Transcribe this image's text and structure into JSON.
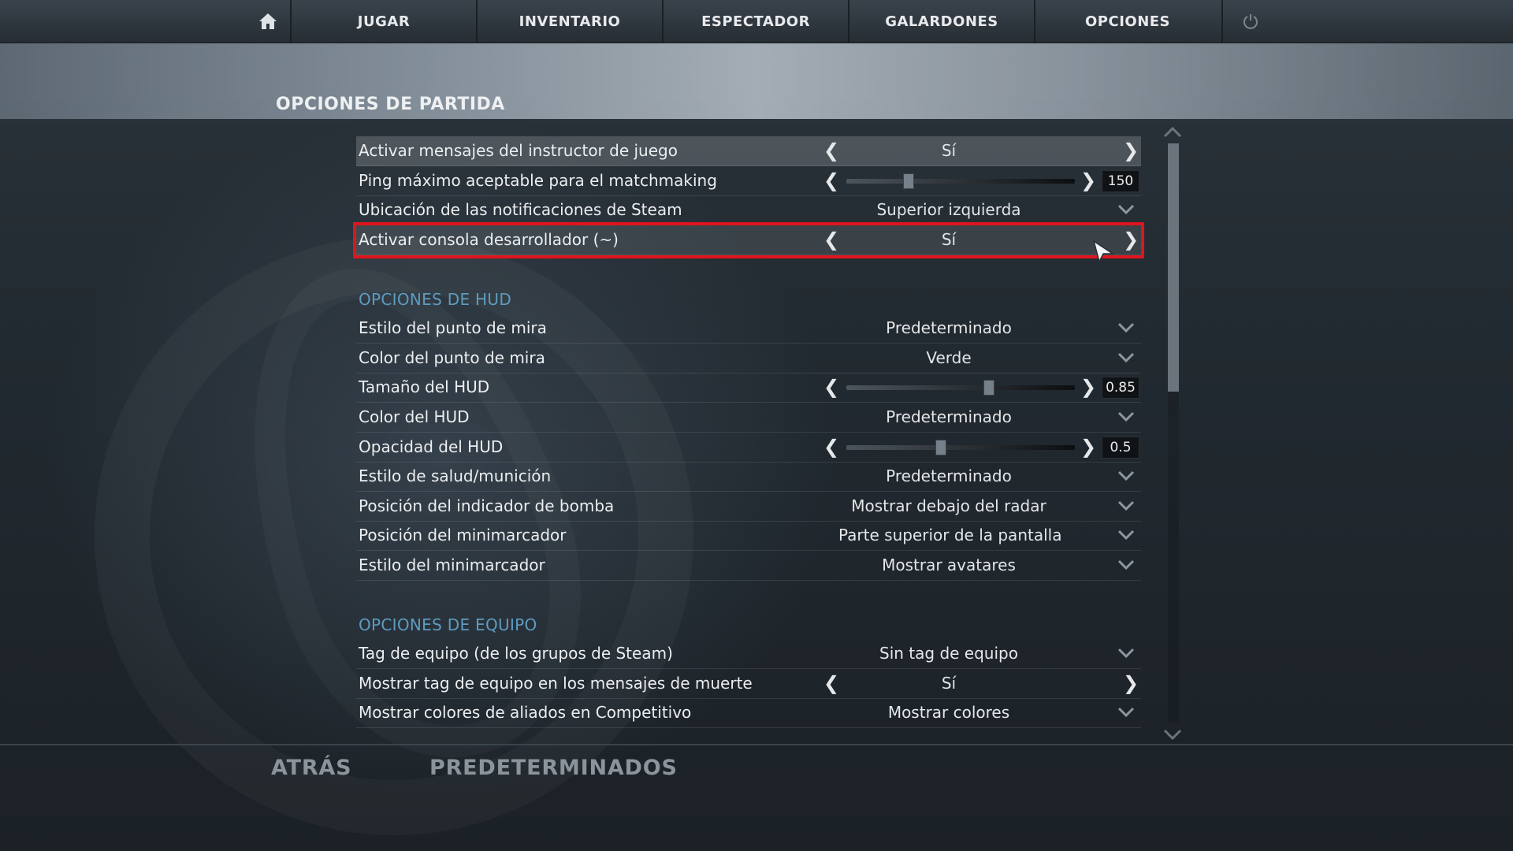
{
  "nav": {
    "home_icon": "home-icon",
    "items": [
      "JUGAR",
      "INVENTARIO",
      "ESPECTADOR",
      "GALARDONES",
      "OPCIONES"
    ],
    "power_icon": "power-icon"
  },
  "page_title": "OPCIONES DE PARTIDA",
  "rows": {
    "instructor": {
      "label": "Activar mensajes del instructor de juego",
      "value": "Sí"
    },
    "ping": {
      "label": "Ping máximo aceptable para el matchmaking",
      "value": "150",
      "fraction": 0.27
    },
    "steam_notif": {
      "label": "Ubicación de las notificaciones de Steam",
      "value": "Superior izquierda"
    },
    "dev_console": {
      "label": "Activar consola desarrollador (~)",
      "value": "Sí"
    }
  },
  "hud": {
    "section_title": "OPCIONES DE HUD",
    "crosshair_style": {
      "label": "Estilo del punto de mira",
      "value": "Predeterminado"
    },
    "crosshair_color": {
      "label": "Color del punto de mira",
      "value": "Verde"
    },
    "hud_size": {
      "label": "Tamaño del HUD",
      "value": "0.85",
      "fraction": 0.62
    },
    "hud_color": {
      "label": "Color del HUD",
      "value": "Predeterminado"
    },
    "hud_opacity": {
      "label": "Opacidad del HUD",
      "value": "0.5",
      "fraction": 0.41
    },
    "health_ammo": {
      "label": "Estilo de salud/munición",
      "value": "Predeterminado"
    },
    "bomb_indicator": {
      "label": "Posición del indicador de bomba",
      "value": "Mostrar debajo del radar"
    },
    "miniscore_pos": {
      "label": "Posición del minimarcador",
      "value": "Parte superior de la pantalla"
    },
    "miniscore_style": {
      "label": "Estilo del minimarcador",
      "value": "Mostrar avatares"
    }
  },
  "team": {
    "section_title": "OPCIONES DE EQUIPO",
    "team_tag": {
      "label": "Tag de equipo (de los grupos de Steam)",
      "value": "Sin tag de equipo"
    },
    "show_tag_kill": {
      "label": "Mostrar tag de equipo en los mensajes de muerte",
      "value": "Sí"
    },
    "ally_colors": {
      "label": "Mostrar colores de aliados en Competitivo",
      "value": "Mostrar colores"
    }
  },
  "footer": {
    "back": "ATRÁS",
    "defaults": "PREDETERMINADOS"
  },
  "colors": {
    "section_accent": "#5e9bbf",
    "selection_outline": "#e0141c"
  }
}
